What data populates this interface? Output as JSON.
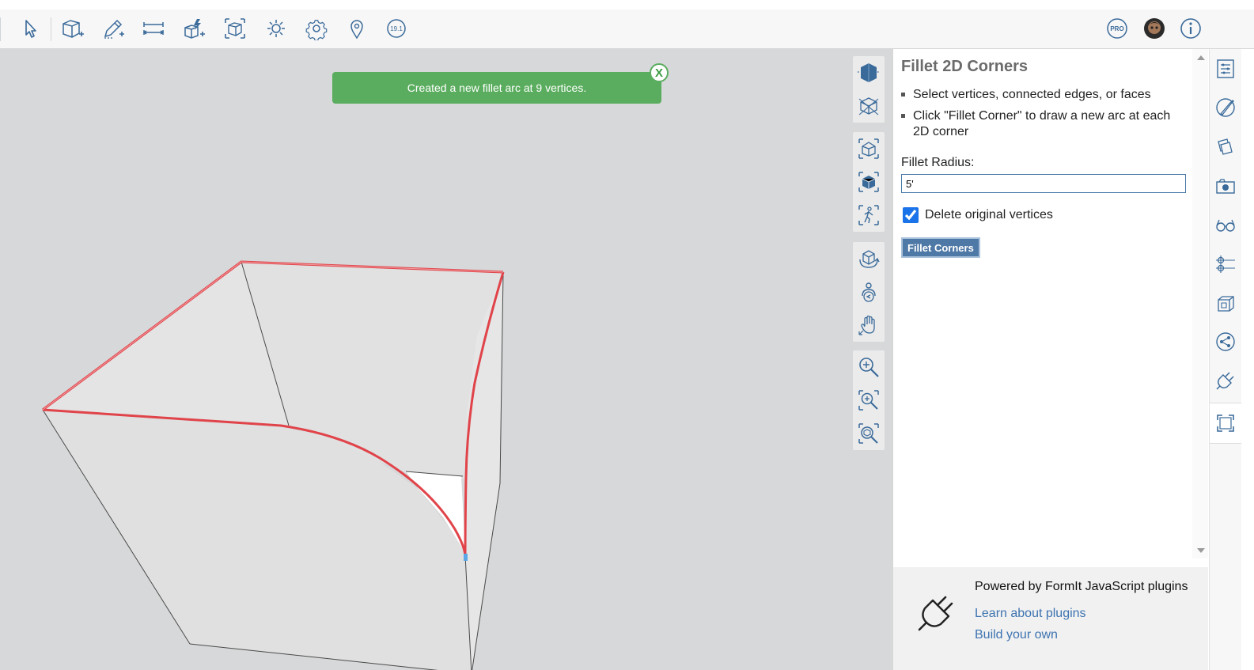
{
  "toolbar": {
    "items": [
      "select-tool",
      "solid-tools",
      "draw-tools",
      "measure-tools",
      "alter-tools",
      "group-tools",
      "lighting",
      "settings",
      "location",
      "version"
    ],
    "version_label": "19.1",
    "pro_label": "PRO"
  },
  "notification": {
    "message": "Created a new fillet arc at 9 vertices.",
    "close_label": "X"
  },
  "panel": {
    "title": "Fillet 2D Corners",
    "instructions": [
      "Select vertices, connected edges, or faces",
      "Click \"Fillet Corner\" to draw a new arc at each 2D corner"
    ],
    "radius_label": "Fillet Radius:",
    "radius_value": "5'",
    "delete_label": "Delete original vertices",
    "delete_checked": true,
    "button_label": "Fillet Corners"
  },
  "footer": {
    "powered": "Powered by FormIt JavaScript plugins",
    "learn": "Learn about plugins",
    "build": "Build your own"
  },
  "colors": {
    "accent": "#4e78a6",
    "success": "#5aad5e",
    "selection": "#e0444a",
    "link": "#3d73b0"
  }
}
